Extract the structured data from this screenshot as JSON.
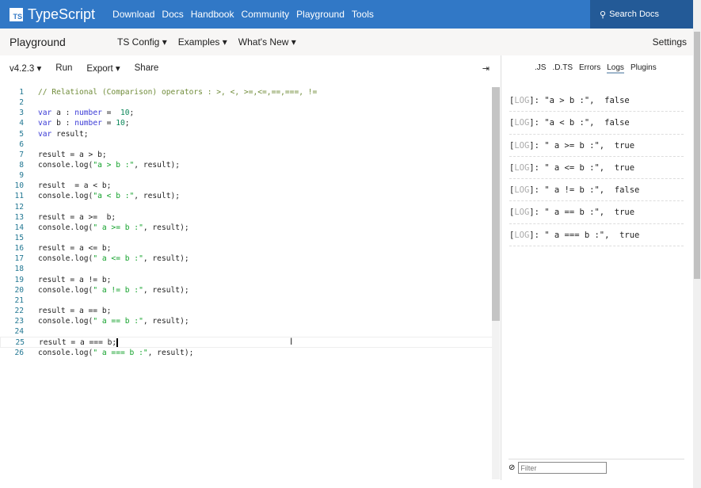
{
  "brand": {
    "logo": "TS",
    "name": "TypeScript"
  },
  "nav": [
    "Download",
    "Docs",
    "Handbook",
    "Community",
    "Playground",
    "Tools"
  ],
  "search": {
    "icon": "search-icon",
    "label": "Search Docs"
  },
  "subbar": {
    "title": "Playground",
    "menus": [
      "TS Config ▾",
      "Examples ▾",
      "What's New ▾"
    ],
    "settings": "Settings"
  },
  "toolbar": {
    "version": "v4.2.3 ▾",
    "run": "Run",
    "export": "Export ▾",
    "share": "Share",
    "collapse": "⇥"
  },
  "colors": {
    "brand": "#3178c6",
    "search_bg": "#235a97"
  },
  "editor": {
    "lines": [
      [
        [
          "c",
          "// Relational (Comparison) operators : >, <, >=,<=,==,===, !="
        ]
      ],
      [],
      [
        [
          "k",
          "var"
        ],
        [
          "p",
          " a : "
        ],
        [
          "k",
          "number"
        ],
        [
          "p",
          " =  "
        ],
        [
          "n",
          "10"
        ],
        [
          "p",
          ";"
        ]
      ],
      [
        [
          "k",
          "var"
        ],
        [
          "p",
          " b : "
        ],
        [
          "k",
          "number"
        ],
        [
          "p",
          " = "
        ],
        [
          "n",
          "10"
        ],
        [
          "p",
          ";"
        ]
      ],
      [
        [
          "k",
          "var"
        ],
        [
          "p",
          " result;"
        ]
      ],
      [],
      [
        [
          "p",
          "result = a > b;"
        ]
      ],
      [
        [
          "p",
          "console.log("
        ],
        [
          "s",
          "\"a > b :\""
        ],
        [
          "p",
          ", result);"
        ]
      ],
      [],
      [
        [
          "p",
          "result  = a < b;"
        ]
      ],
      [
        [
          "p",
          "console.log("
        ],
        [
          "s",
          "\"a < b :\""
        ],
        [
          "p",
          ", result);"
        ]
      ],
      [],
      [
        [
          "p",
          "result = a >=  b;"
        ]
      ],
      [
        [
          "p",
          "console.log("
        ],
        [
          "s",
          "\" a >= b :\""
        ],
        [
          "p",
          ", result);"
        ]
      ],
      [],
      [
        [
          "p",
          "result = a <= b;"
        ]
      ],
      [
        [
          "p",
          "console.log("
        ],
        [
          "s",
          "\" a <= b :\""
        ],
        [
          "p",
          ", result);"
        ]
      ],
      [],
      [
        [
          "p",
          "result = a != b;"
        ]
      ],
      [
        [
          "p",
          "console.log("
        ],
        [
          "s",
          "\" a != b :\""
        ],
        [
          "p",
          ", result);"
        ]
      ],
      [],
      [
        [
          "p",
          "result = a == b;"
        ]
      ],
      [
        [
          "p",
          "console.log("
        ],
        [
          "s",
          "\" a == b :\""
        ],
        [
          "p",
          ", result);"
        ]
      ],
      [],
      [
        [
          "p",
          "result = a === b;"
        ]
      ],
      [
        [
          "p",
          "console.log("
        ],
        [
          "s",
          "\" a === b :\""
        ],
        [
          "p",
          ", result);"
        ]
      ]
    ],
    "active_line": 25
  },
  "output": {
    "tabs": [
      ".JS",
      ".D.TS",
      "Errors",
      "Logs",
      "Plugins"
    ],
    "active_tab": "Logs",
    "logs": [
      {
        "tag": "LOG",
        "msg": "\"a > b :\",  false"
      },
      {
        "tag": "LOG",
        "msg": "\"a < b :\",  false"
      },
      {
        "tag": "LOG",
        "msg": "\" a >= b :\",  true"
      },
      {
        "tag": "LOG",
        "msg": "\" a <= b :\",  true"
      },
      {
        "tag": "LOG",
        "msg": "\" a != b :\",  false"
      },
      {
        "tag": "LOG",
        "msg": "\" a == b :\",  true"
      },
      {
        "tag": "LOG",
        "msg": "\" a === b :\",  true"
      }
    ],
    "filter": {
      "placeholder": "Filter",
      "icon": "no-filter-icon"
    }
  }
}
